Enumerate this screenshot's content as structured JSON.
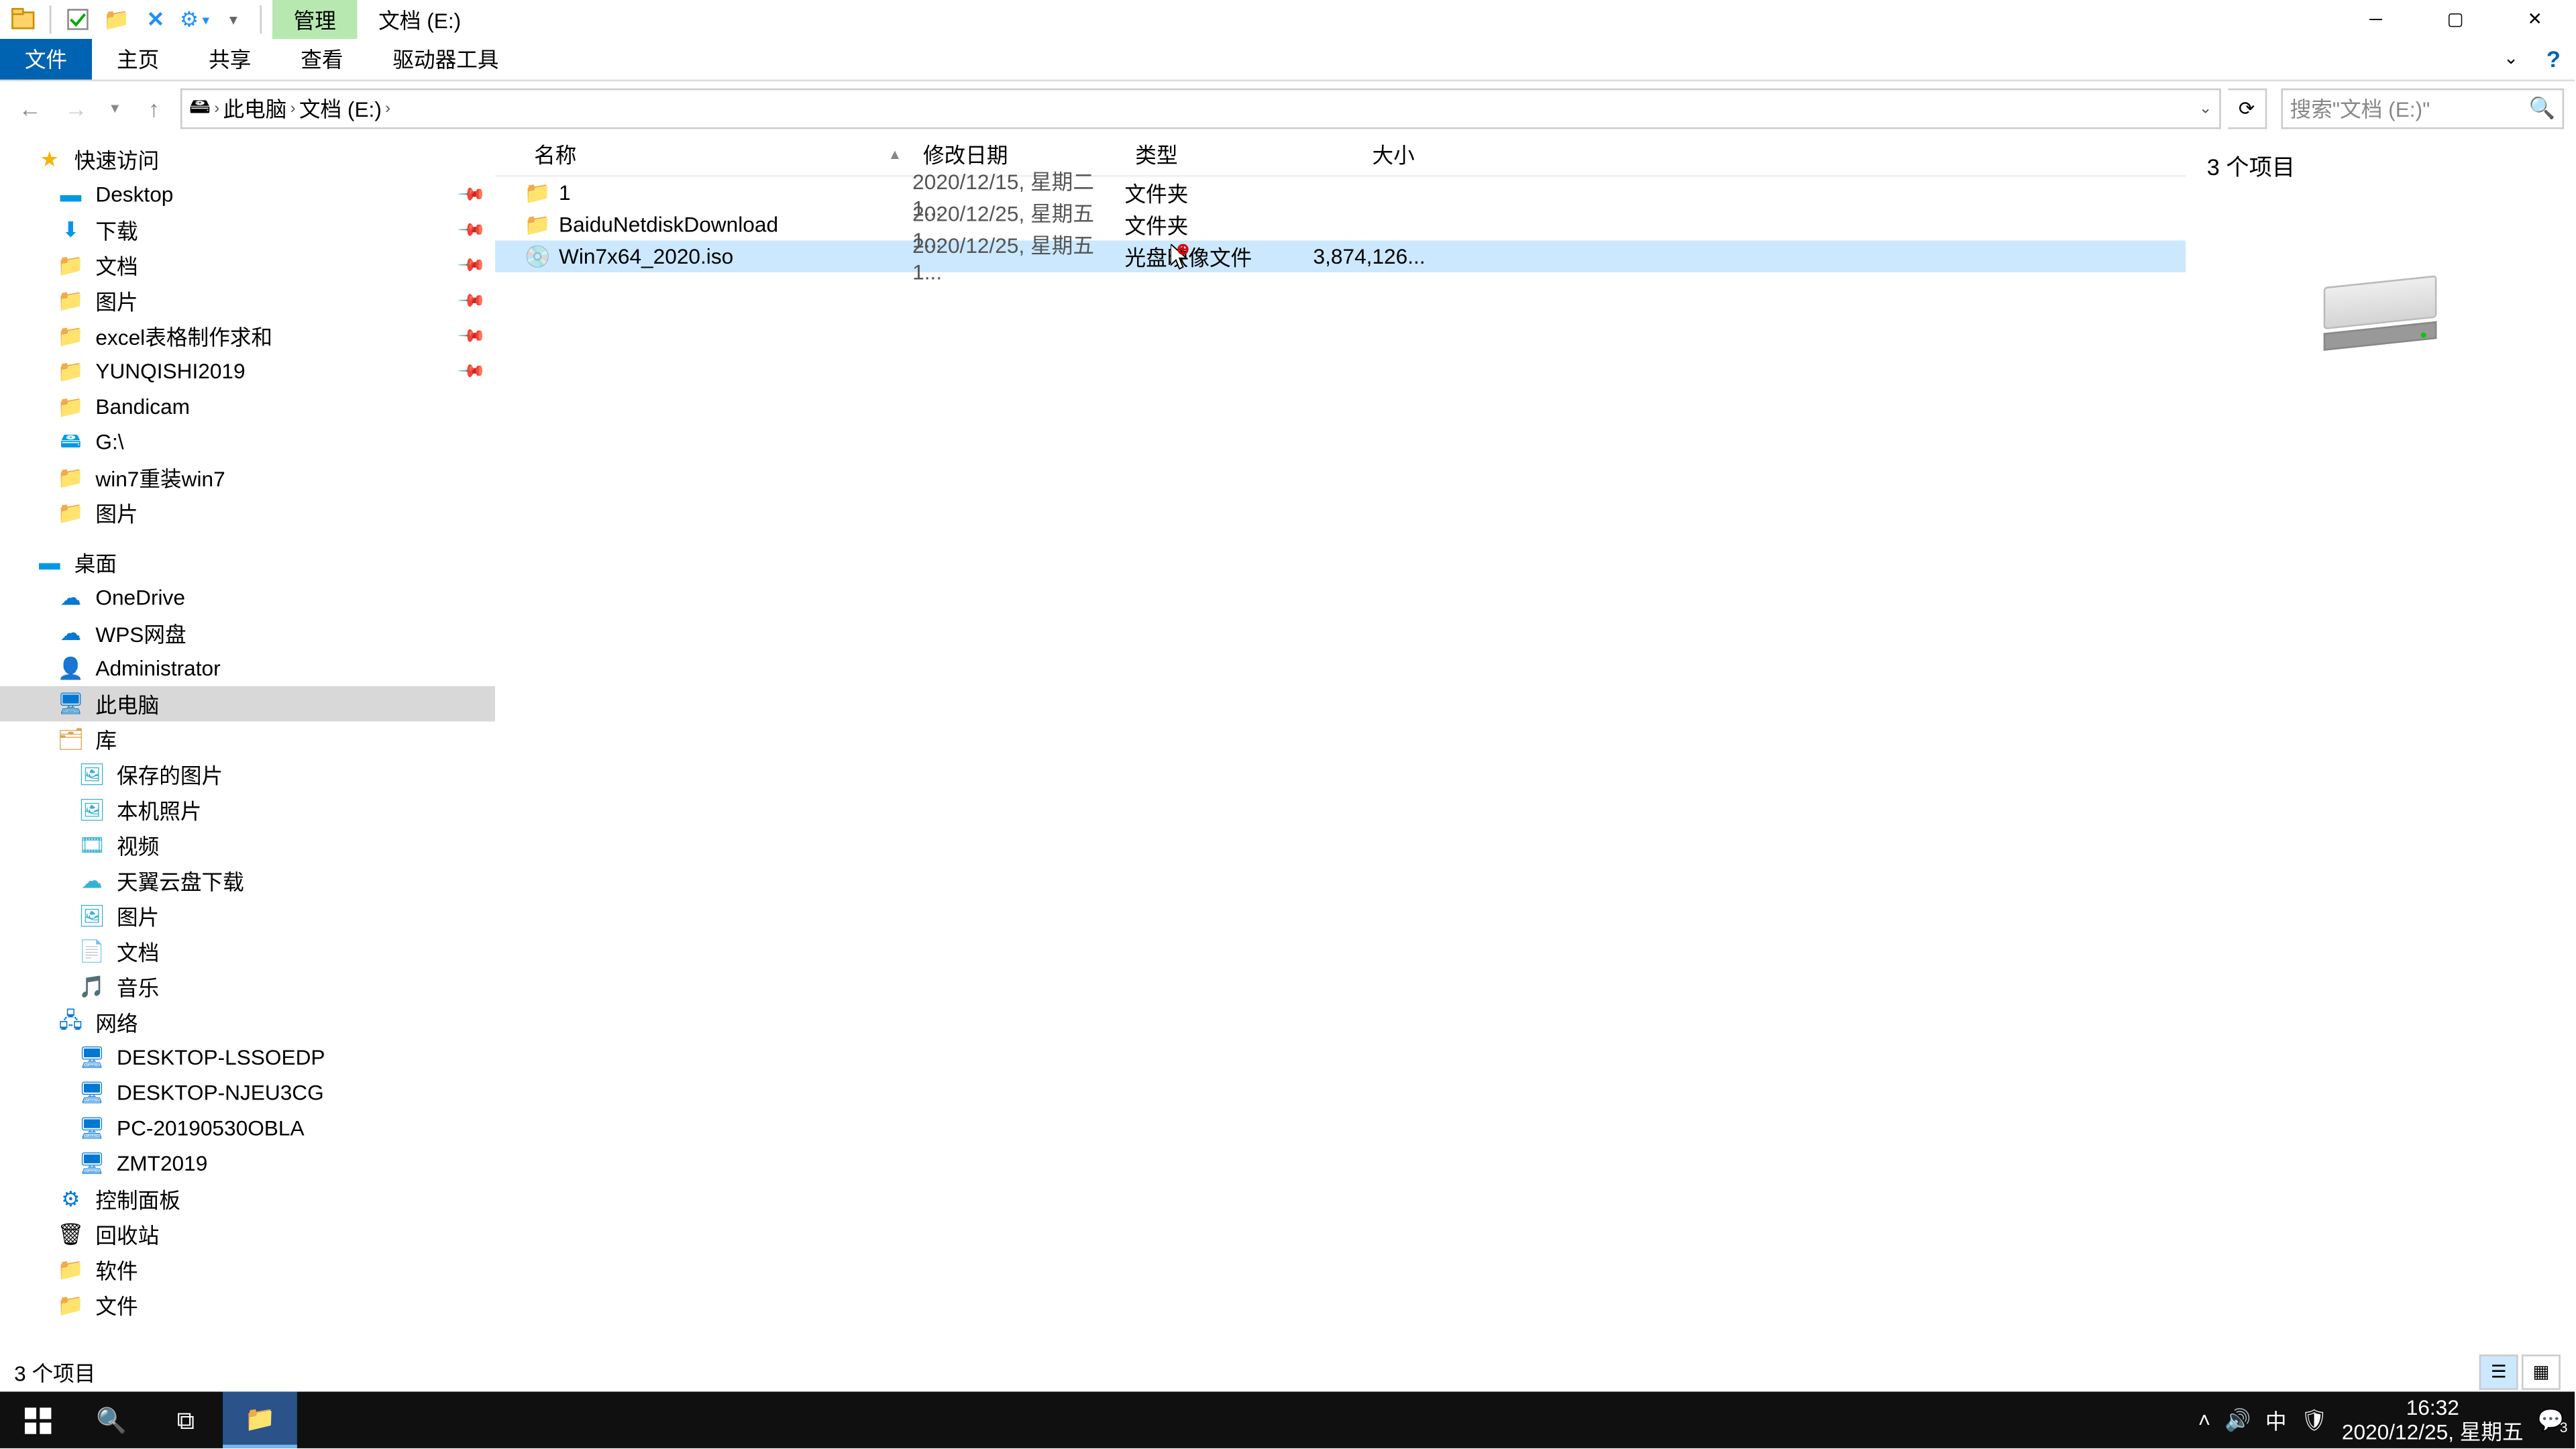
{
  "title": {
    "contextual_tab": "管理",
    "window_title": "文档 (E:)"
  },
  "ribbon": {
    "file": "文件",
    "home": "主页",
    "share": "共享",
    "view": "查看",
    "drive_tools": "驱动器工具"
  },
  "address": {
    "this_pc": "此电脑",
    "drive": "文档 (E:)",
    "search_placeholder": "搜索\"文档 (E:)\""
  },
  "columns": {
    "name": "名称",
    "date": "修改日期",
    "type": "类型",
    "size": "大小"
  },
  "files": [
    {
      "icon": "📁",
      "name": "1",
      "date": "2020/12/15, 星期二 1...",
      "type": "文件夹",
      "size": ""
    },
    {
      "icon": "📁",
      "name": "BaiduNetdiskDownload",
      "date": "2020/12/25, 星期五 1...",
      "type": "文件夹",
      "size": ""
    },
    {
      "icon": "💿",
      "name": "Win7x64_2020.iso",
      "date": "2020/12/25, 星期五 1...",
      "type": "光盘映像文件",
      "size": "3,874,126..."
    }
  ],
  "tree": {
    "quick_access": "快速访问",
    "desktop": "Desktop",
    "downloads": "下载",
    "documents": "文档",
    "pictures": "图片",
    "excel": "excel表格制作求和",
    "yunqishi": "YUNQISHI2019",
    "bandicam": "Bandicam",
    "gdrive": "G:\\",
    "win7": "win7重装win7",
    "pictures2": "图片",
    "desktop2": "桌面",
    "onedrive": "OneDrive",
    "wps": "WPS网盘",
    "admin": "Administrator",
    "this_pc": "此电脑",
    "libraries": "库",
    "saved_pics": "保存的图片",
    "camera": "本机照片",
    "videos": "视频",
    "tianyi": "天翼云盘下载",
    "pictures3": "图片",
    "documents2": "文档",
    "music": "音乐",
    "network": "网络",
    "pc1": "DESKTOP-LSSOEDP",
    "pc2": "DESKTOP-NJEU3CG",
    "pc3": "PC-20190530OBLA",
    "pc4": "ZMT2019",
    "control": "控制面板",
    "recycle": "回收站",
    "software": "软件",
    "files": "文件"
  },
  "preview": {
    "count": "3 个项目"
  },
  "status": {
    "text": "3 个项目"
  },
  "taskbar": {
    "time": "16:32",
    "date": "2020/12/25, 星期五",
    "ime": "中",
    "notif": "3"
  }
}
